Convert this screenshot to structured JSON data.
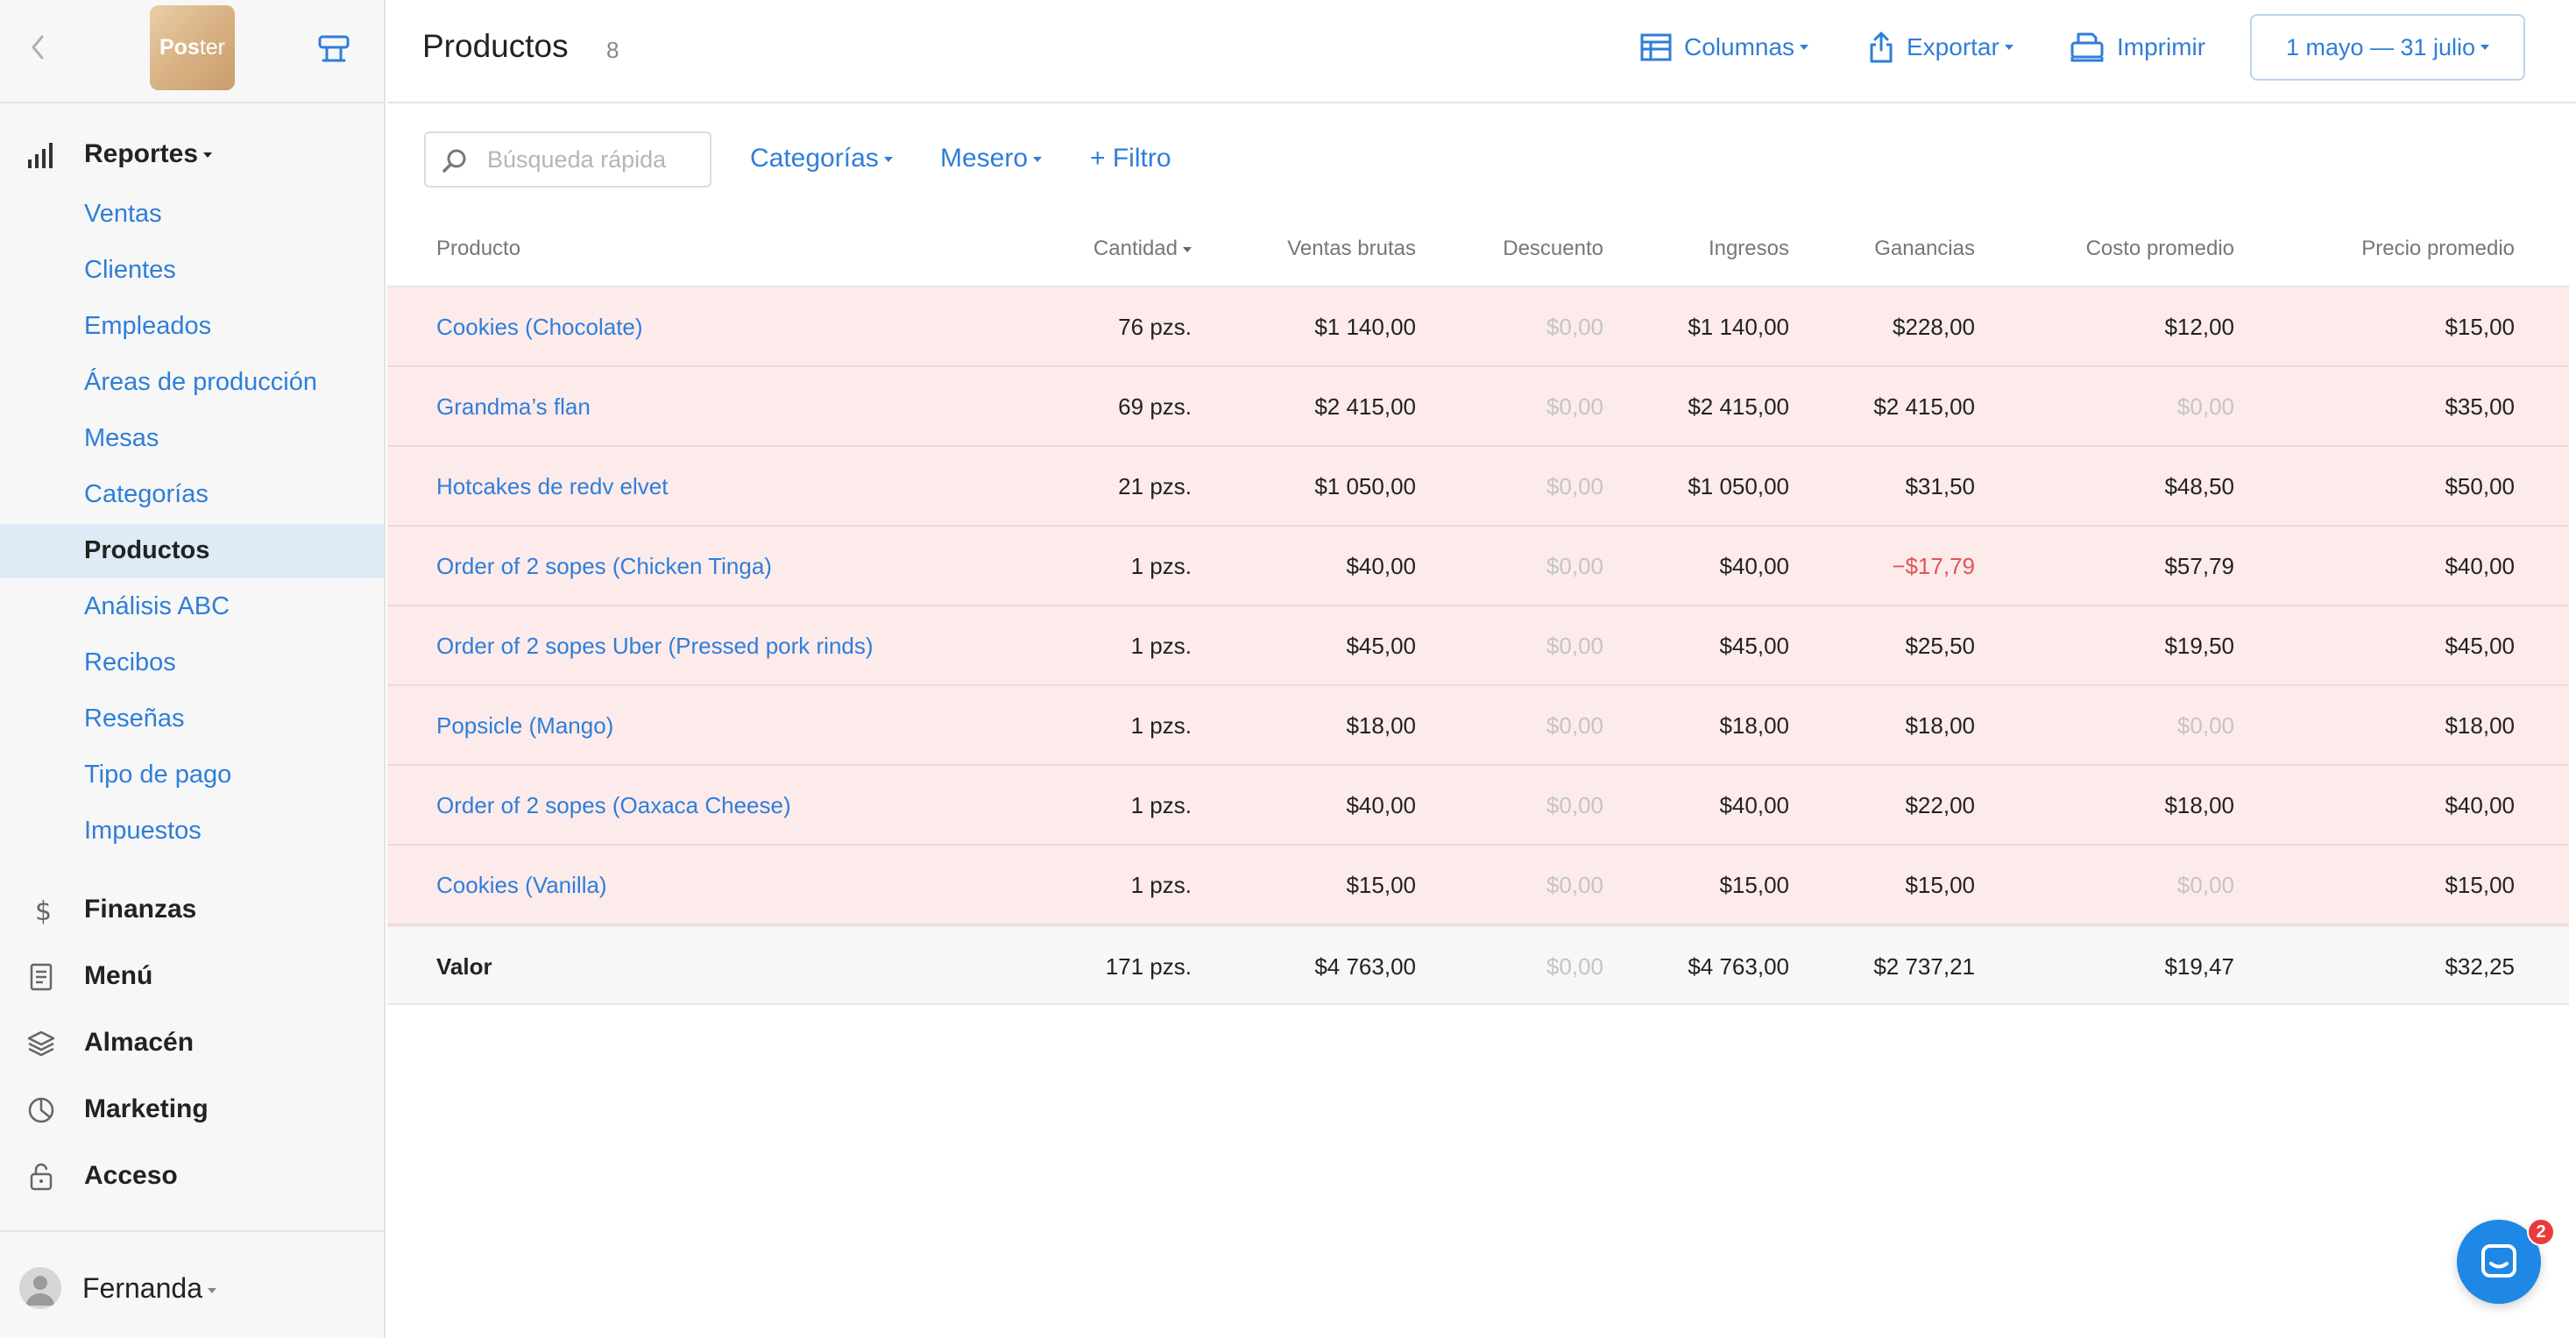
{
  "brand": {
    "logo_text_bold": "Pos",
    "logo_text_thin": "ter"
  },
  "sidebar": {
    "reports_label": "Reportes",
    "report_items": [
      {
        "label": "Ventas"
      },
      {
        "label": "Clientes"
      },
      {
        "label": "Empleados"
      },
      {
        "label": "Áreas de producción"
      },
      {
        "label": "Mesas"
      },
      {
        "label": "Categorías"
      },
      {
        "label": "Productos",
        "active": true
      },
      {
        "label": "Análisis ABC"
      },
      {
        "label": "Recibos"
      },
      {
        "label": "Reseñas"
      },
      {
        "label": "Tipo de pago"
      },
      {
        "label": "Impuestos"
      }
    ],
    "sections": [
      {
        "label": "Finanzas",
        "icon": "dollar-icon"
      },
      {
        "label": "Menú",
        "icon": "document-icon"
      },
      {
        "label": "Almacén",
        "icon": "layers-icon"
      },
      {
        "label": "Marketing",
        "icon": "pie-chart-icon"
      },
      {
        "label": "Acceso",
        "icon": "lock-icon"
      }
    ],
    "user_name": "Fernanda"
  },
  "header": {
    "title": "Productos",
    "count": "8",
    "columns_label": "Columnas",
    "export_label": "Exportar",
    "print_label": "Imprimir",
    "date_range": "1 mayo — 31 julio"
  },
  "filters": {
    "search_placeholder": "Búsqueda rápida",
    "categories_label": "Categorías",
    "waiter_label": "Mesero",
    "add_filter_label": "+ Filtro"
  },
  "table": {
    "columns": [
      "Producto",
      "Cantidad",
      "Ventas brutas",
      "Descuento",
      "Ingresos",
      "Ganancias",
      "Costo promedio",
      "Precio promedio"
    ],
    "rows": [
      {
        "product": "Cookies (Chocolate)",
        "qty": "76 pzs.",
        "gross": "$1 140,00",
        "discount": "$0,00",
        "income": "$1 140,00",
        "profit": "$228,00",
        "avg_cost": "$12,00",
        "avg_price": "$15,00"
      },
      {
        "product": "Grandma’s flan",
        "qty": "69 pzs.",
        "gross": "$2 415,00",
        "discount": "$0,00",
        "income": "$2 415,00",
        "profit": "$2 415,00",
        "avg_cost": "$0,00",
        "avg_price": "$35,00"
      },
      {
        "product": "Hotcakes de redv elvet",
        "qty": "21 pzs.",
        "gross": "$1 050,00",
        "discount": "$0,00",
        "income": "$1 050,00",
        "profit": "$31,50",
        "avg_cost": "$48,50",
        "avg_price": "$50,00"
      },
      {
        "product": "Order of 2 sopes (Chicken Tinga)",
        "qty": "1 pzs.",
        "gross": "$40,00",
        "discount": "$0,00",
        "income": "$40,00",
        "profit": "−$17,79",
        "avg_cost": "$57,79",
        "avg_price": "$40,00"
      },
      {
        "product": "Order of 2 sopes Uber (Pressed pork rinds)",
        "qty": "1 pzs.",
        "gross": "$45,00",
        "discount": "$0,00",
        "income": "$45,00",
        "profit": "$25,50",
        "avg_cost": "$19,50",
        "avg_price": "$45,00"
      },
      {
        "product": "Popsicle (Mango)",
        "qty": "1 pzs.",
        "gross": "$18,00",
        "discount": "$0,00",
        "income": "$18,00",
        "profit": "$18,00",
        "avg_cost": "$0,00",
        "avg_price": "$18,00"
      },
      {
        "product": "Order of 2 sopes (Oaxaca Cheese)",
        "qty": "1 pzs.",
        "gross": "$40,00",
        "discount": "$0,00",
        "income": "$40,00",
        "profit": "$22,00",
        "avg_cost": "$18,00",
        "avg_price": "$40,00"
      },
      {
        "product": "Cookies (Vanilla)",
        "qty": "1 pzs.",
        "gross": "$15,00",
        "discount": "$0,00",
        "income": "$15,00",
        "profit": "$15,00",
        "avg_cost": "$0,00",
        "avg_price": "$15,00"
      }
    ],
    "total": {
      "label": "Valor",
      "qty": "171 pzs.",
      "gross": "$4 763,00",
      "discount": "$0,00",
      "income": "$4 763,00",
      "profit": "$2 737,21",
      "avg_cost": "$19,47",
      "avg_price": "$32,25"
    }
  },
  "chat": {
    "badge": "2"
  },
  "colors": {
    "accent": "#2f7ed8",
    "row_highlight": "#fdebec",
    "negative": "#e0554f",
    "muted": "#c4c4c4"
  }
}
